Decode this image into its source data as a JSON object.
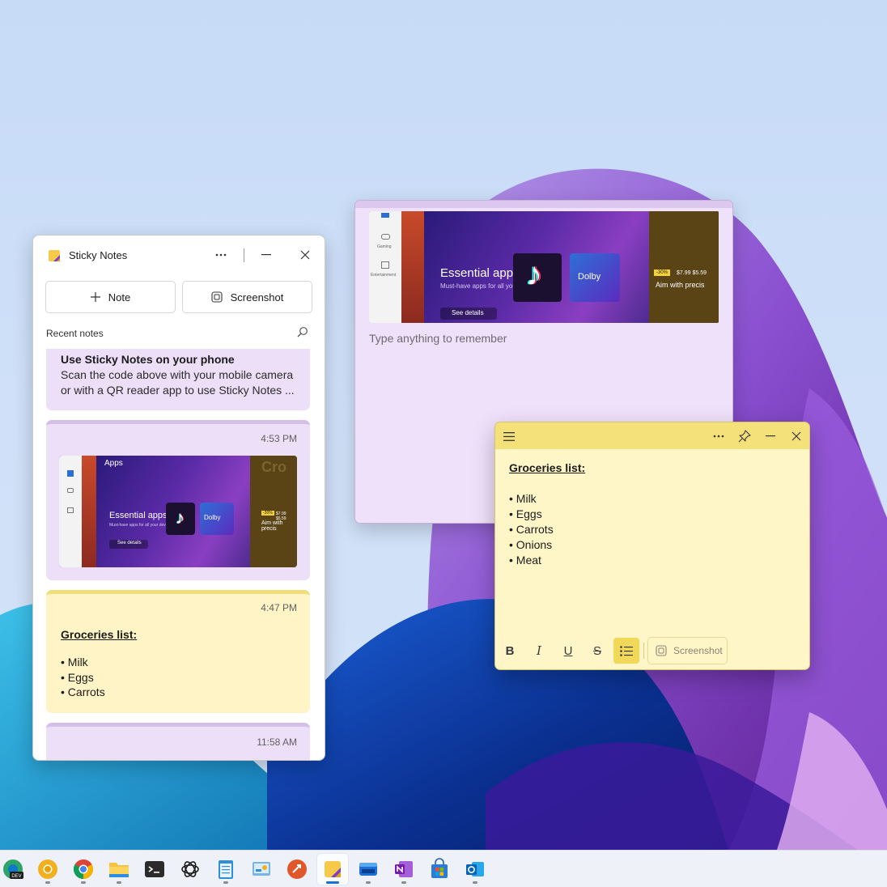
{
  "list_window": {
    "app_title": "Sticky Notes",
    "note_button_label": "Note",
    "screenshot_button_label": "Screenshot",
    "recent_label": "Recent notes",
    "notes": [
      {
        "title": "Use Sticky Notes on your phone",
        "text": "Scan the code above with your mobile camera or with a QR reader app to use Sticky Notes ..."
      },
      {
        "time": "4:53 PM",
        "thumbnail": {
          "apps_label": "Apps",
          "headline": "Essential apps",
          "subline": "Must-have apps for all your devices",
          "see_details": "See details",
          "dolby": "Dolby",
          "discount": "-30%",
          "prices": "$7.99 $5.59",
          "aim": "Aim with precis",
          "right_title": "Cro"
        }
      },
      {
        "time": "4:47 PM",
        "title": "Groceries list:",
        "items": [
          "• Milk",
          "• Eggs",
          "• Carrots"
        ]
      },
      {
        "time": "11:58 AM"
      }
    ]
  },
  "purple_note": {
    "thumbnail": {
      "headline": "Essential apps",
      "subline": "Must-have apps for all your devices",
      "see_details": "See details",
      "dolby": "Dolby",
      "discount": "-30%",
      "prices": "$7.99 $5.59",
      "aim": "Aim with precis",
      "nav_gaming": "Gaming",
      "nav_entertainment": "Entertainment"
    },
    "placeholder": "Type anything to remember"
  },
  "yellow_note": {
    "title": "Groceries list:",
    "items": [
      "• Milk",
      "• Eggs",
      "• Carrots",
      "• Onions",
      "• Meat"
    ],
    "format_bold": "B",
    "format_italic": "I",
    "format_underline": "U",
    "format_strike": "S",
    "screenshot_label": "Screenshot"
  },
  "taskbar": {
    "apps": [
      "edge-dev",
      "chrome-canary",
      "chrome",
      "file-explorer",
      "terminal",
      "chatgpt",
      "notepad",
      "control-panel",
      "remote-desktop",
      "sticky-notes",
      "media-player",
      "onenote",
      "microsoft-store",
      "outlook"
    ],
    "active_app": "sticky-notes",
    "edge_dev_badge": "DEV"
  },
  "colors": {
    "note_purple": "#eedff9",
    "note_yellow": "#fff4c6",
    "yellow_header": "#f5e17a",
    "accent_blue": "#1a6ed8"
  }
}
